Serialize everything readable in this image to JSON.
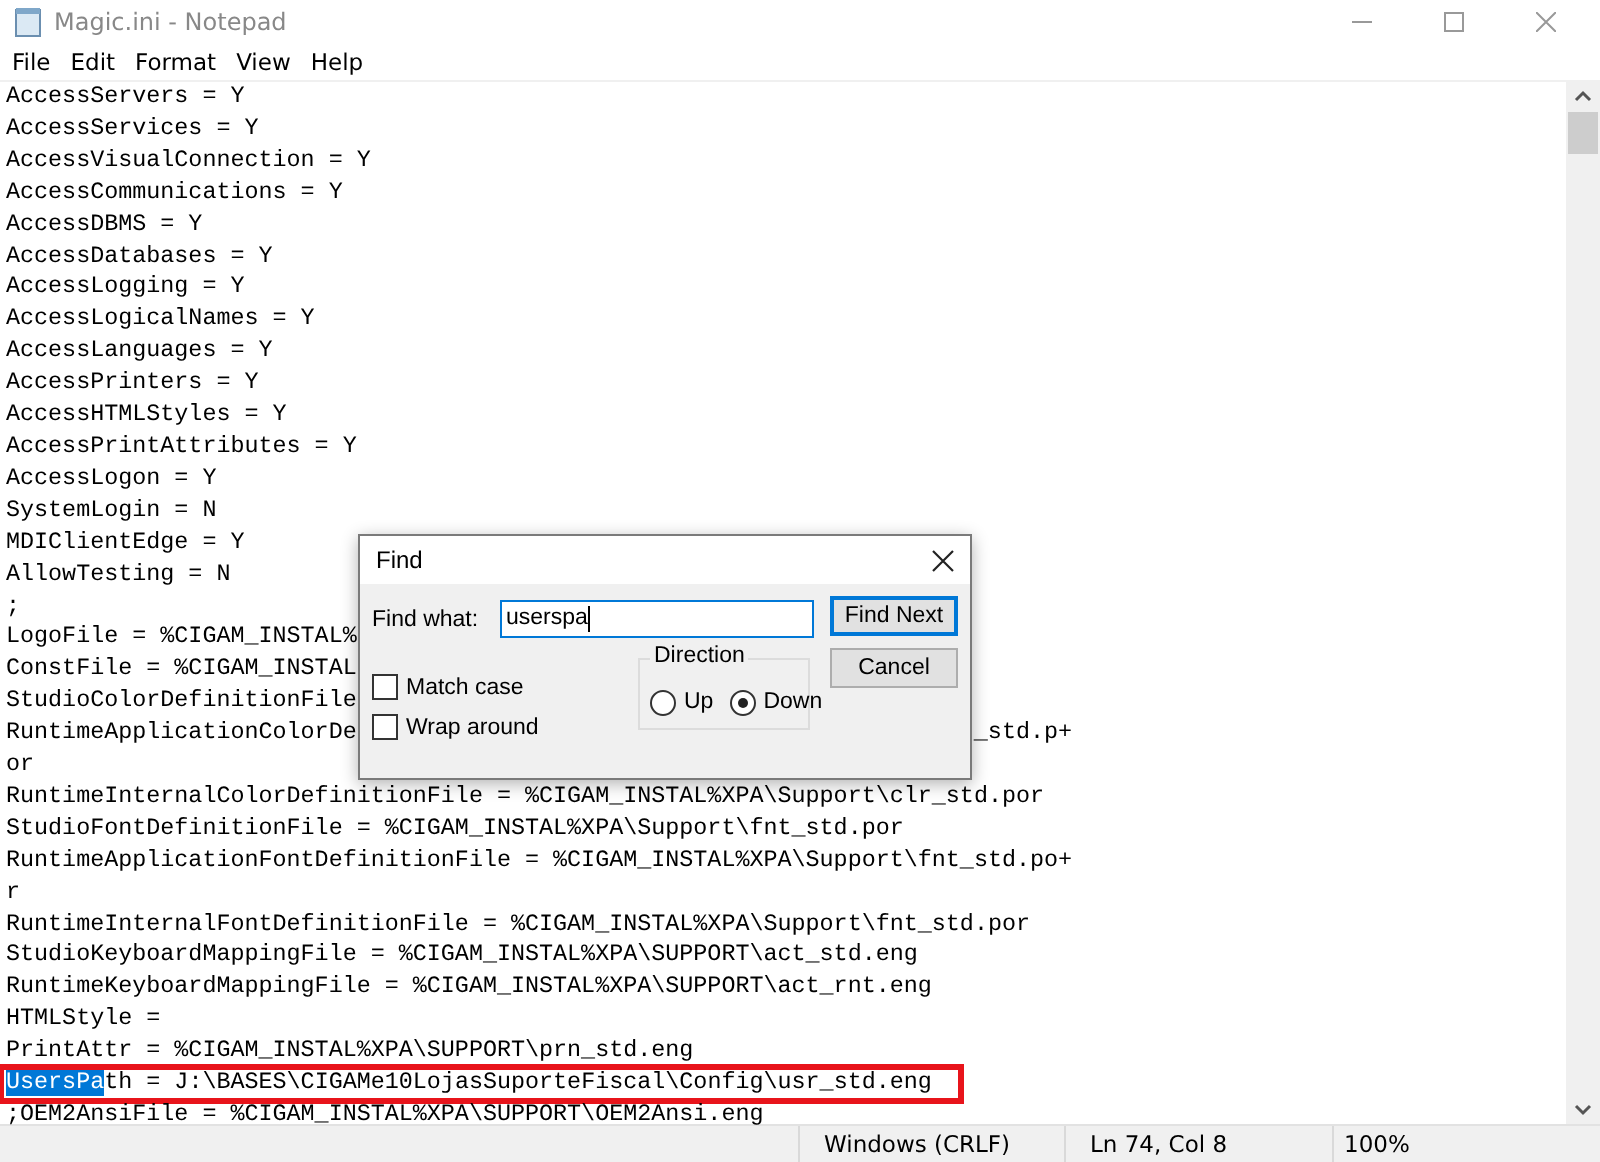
{
  "window": {
    "title": "Magic.ini - Notepad"
  },
  "menu": [
    "File",
    "Edit",
    "Format",
    "View",
    "Help"
  ],
  "lines": [
    {
      "text": "AccessServers = Y"
    },
    {
      "text": "AccessServices = Y"
    },
    {
      "text": "AccessVisualConnection = Y"
    },
    {
      "text": "AccessCommunications = Y"
    },
    {
      "text": "AccessDBMS = Y"
    },
    {
      "text": "AccessDatabases = Y"
    },
    {
      "text": "AccessLogging = Y"
    },
    {
      "text": "AccessLogicalNames = Y"
    },
    {
      "text": "AccessLanguages = Y"
    },
    {
      "text": "AccessPrinters = Y"
    },
    {
      "text": "AccessHTMLStyles = Y"
    },
    {
      "text": "AccessPrintAttributes = Y"
    },
    {
      "text": "AccessLogon = Y"
    },
    {
      "text": "SystemLogin = N"
    },
    {
      "text": "MDIClientEdge = Y"
    },
    {
      "text": "AllowTesting = N"
    },
    {
      "text": ";"
    },
    {
      "text": "LogoFile = %CIGAM_INSTAL%"
    },
    {
      "text": "ConstFile = %CIGAM_INSTAL"
    },
    {
      "text": "StudioColorDefinitionFile"
    },
    {
      "text": "RuntimeApplicationColorDe",
      "wrap_tail": "_std.p+"
    },
    {
      "text": "or"
    },
    {
      "text": "RuntimeInternalColorDefinitionFile = %CIGAM_INSTAL%XPA\\Support\\clr_std.por"
    },
    {
      "text": "StudioFontDefinitionFile = %CIGAM_INSTAL%XPA\\Support\\fnt_std.por"
    },
    {
      "text": "RuntimeApplicationFontDefinitionFile = %CIGAM_INSTAL%XPA\\Support\\fnt_std.po+"
    },
    {
      "text": "r"
    },
    {
      "text": "RuntimeInternalFontDefinitionFile = %CIGAM_INSTAL%XPA\\Support\\fnt_std.por"
    },
    {
      "text": "StudioKeyboardMappingFile = %CIGAM_INSTAL%XPA\\SUPPORT\\act_std.eng"
    },
    {
      "text": "RuntimeKeyboardMappingFile = %CIGAM_INSTAL%XPA\\SUPPORT\\act_rnt.eng"
    },
    {
      "text": "HTMLStyle ="
    },
    {
      "text": "PrintAttr = %CIGAM_INSTAL%XPA\\SUPPORT\\prn_std.eng"
    },
    {
      "selected_part": "UsersPa",
      "text": "th = J:\\BASES\\CIGAMe10LojasSuporteFiscal\\Config\\usr_std.eng",
      "outlined": true
    },
    {
      "text": ";OEM2AnsiFile = %CIGAM_INSTAL%XPA\\SUPPORT\\OEM2Ansi.eng"
    }
  ],
  "find_dialog": {
    "title": "Find",
    "find_what_label": "Find what:",
    "find_what_value": "userspa",
    "buttons": [
      {
        "label": "Find Next",
        "default": true
      },
      {
        "label": "Cancel",
        "default": false
      }
    ],
    "checkboxes": [
      {
        "label": "Match case",
        "checked": false
      },
      {
        "label": "Wrap around",
        "checked": false
      }
    ],
    "direction": {
      "label": "Direction",
      "options": [
        {
          "label": "Up",
          "selected": false
        },
        {
          "label": "Down",
          "selected": true
        }
      ]
    }
  },
  "status_bar": [
    "Windows (CRLF)",
    "Ln 74, Col 8",
    "100%"
  ]
}
